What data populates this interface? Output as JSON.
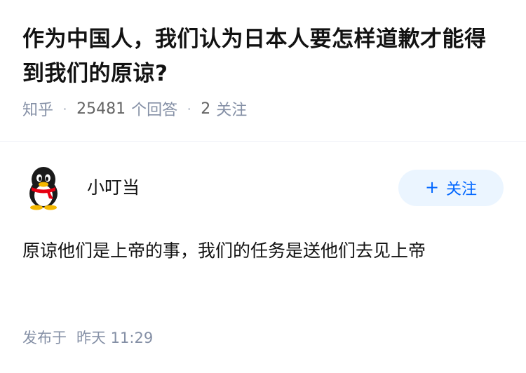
{
  "question": {
    "title": "作为中国人，我们认为日本人要怎样道歉才能得到我们的原谅?",
    "source": "知乎",
    "answer_count": "25481",
    "answer_label": "个回答",
    "follow_count": "2",
    "follow_label": "关注"
  },
  "answer": {
    "author": {
      "name": "小叮当",
      "avatar_icon": "qq-penguin-icon"
    },
    "follow_button_label": "关注",
    "content": "原谅他们是上帝的事，我们的任务是送他们去见上帝",
    "published_label": "发布于",
    "published_time": "昨天 11:29"
  },
  "colors": {
    "title": "#121212",
    "meta": "#8590a6",
    "accent": "#0066ff",
    "follow_bg": "#ebf5ff"
  }
}
